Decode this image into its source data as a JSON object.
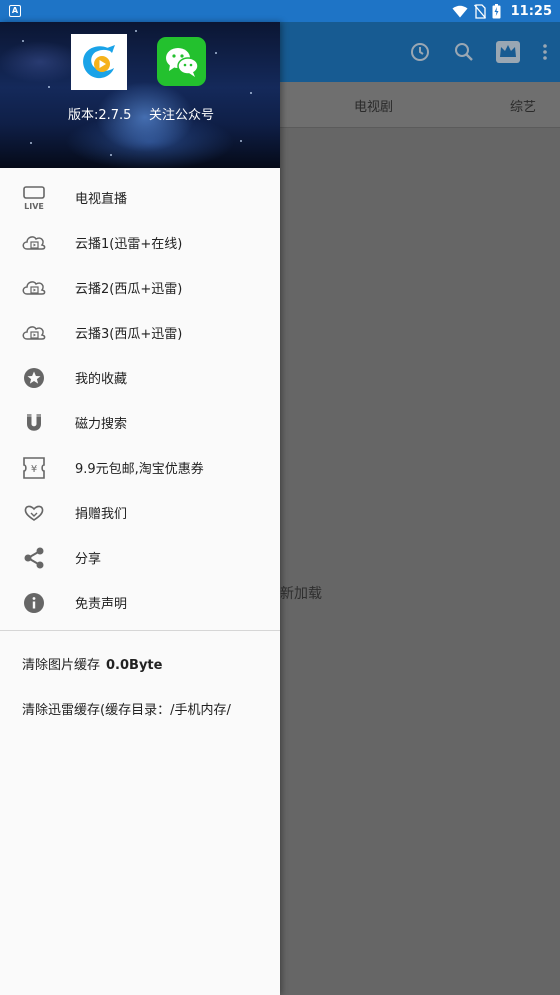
{
  "status_bar": {
    "time": "11:25",
    "app_badge": "A"
  },
  "tabs": [
    "电视剧",
    "综艺"
  ],
  "loading_text": "新加载",
  "header": {
    "version": "版本:2.7.5",
    "follow": "关注公众号"
  },
  "menu": {
    "items": [
      {
        "icon": "live-tv-icon",
        "icon_text": "LIVE",
        "label": "电视直播"
      },
      {
        "icon": "cloud-play-icon",
        "label": "云播1(迅雷+在线)"
      },
      {
        "icon": "cloud-play-icon",
        "label": "云播2(西瓜+迅雷)"
      },
      {
        "icon": "cloud-play-icon",
        "label": "云播3(西瓜+迅雷)"
      },
      {
        "icon": "star-icon",
        "label": "我的收藏"
      },
      {
        "icon": "magnet-icon",
        "label": "磁力搜索"
      },
      {
        "icon": "coupon-icon",
        "icon_text": "¥",
        "label": "9.9元包邮,淘宝优惠券"
      },
      {
        "icon": "heart-icon",
        "label": "捐赠我们"
      },
      {
        "icon": "share-icon",
        "label": "分享"
      },
      {
        "icon": "info-icon",
        "label": "免责声明"
      }
    ]
  },
  "cache": {
    "image_label": "清除图片缓存",
    "image_size": "0.0Byte",
    "thunder_label": "清除迅雷缓存(缓存目录：/手机内存/"
  },
  "colors": {
    "status_bar": "#1e74c6",
    "app_bar_dimmed": "#175b92",
    "scrim_bg": "#666666",
    "drawer_bg": "#fafafa",
    "wechat_green": "#23c12e",
    "icon_gray": "#666666"
  }
}
